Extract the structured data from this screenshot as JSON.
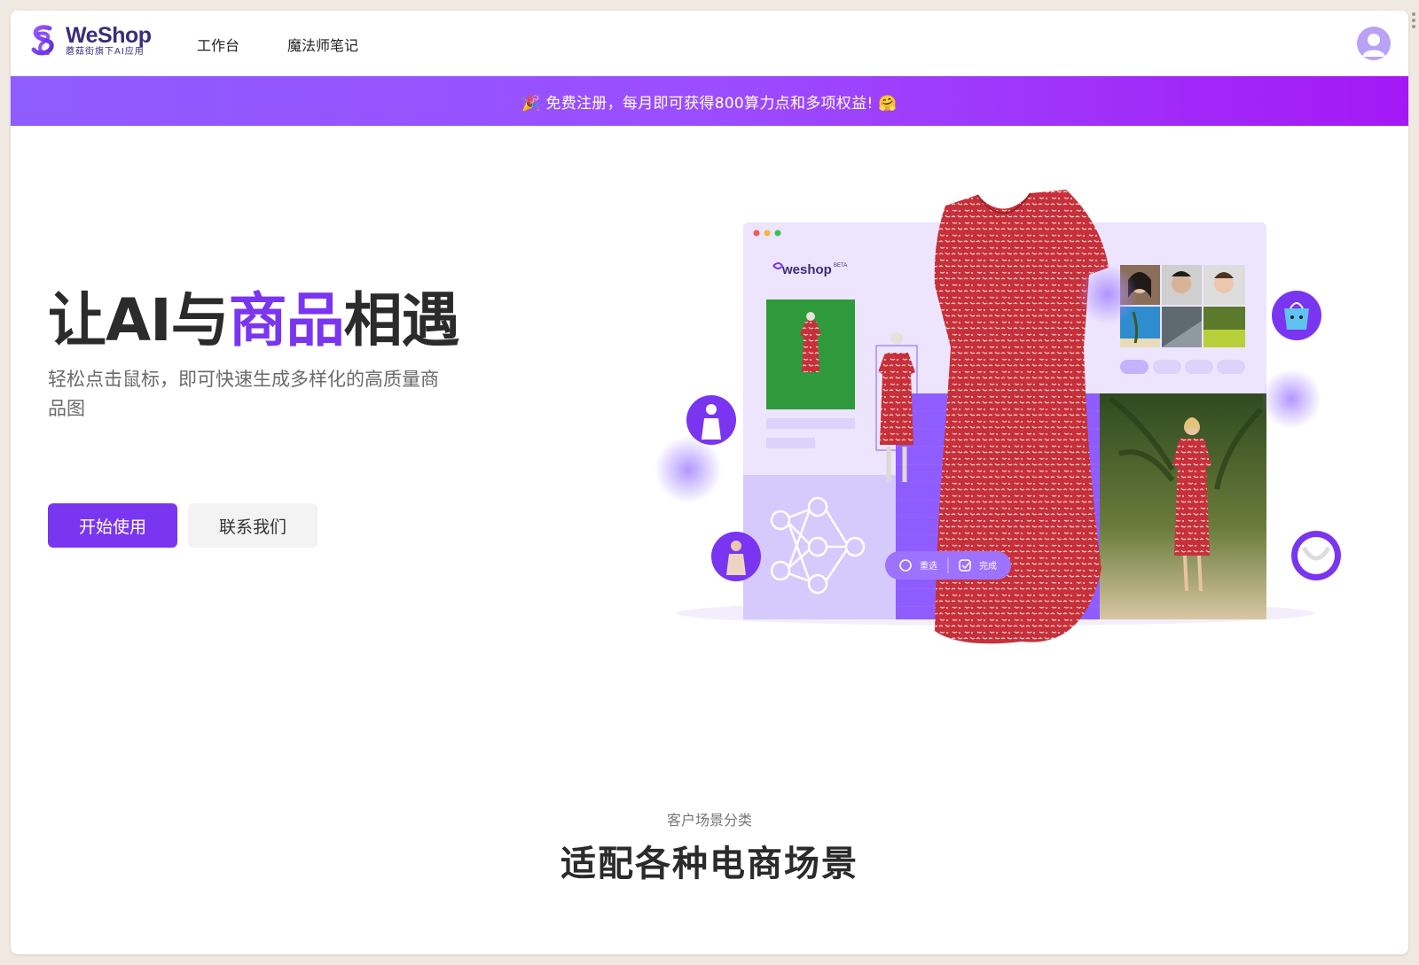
{
  "app": {
    "logo_name": "WeShop",
    "logo_sub": "蘑菇街旗下AI应用"
  },
  "nav": {
    "items": [
      {
        "label": "工作台"
      },
      {
        "label": "魔法师笔记"
      }
    ]
  },
  "banner": {
    "text": "🎉 免费注册，每月即可获得800算力点和多项权益! 🤗"
  },
  "hero": {
    "title_part1": "让AI与",
    "title_accent": "商品",
    "title_part2": "相遇",
    "subtitle": "轻松点击鼠标，即可快速生成多样化的高质量商品图",
    "primary_button": "开始使用",
    "secondary_button": "联系我们"
  },
  "illustration": {
    "app_name": "weshop",
    "beta_tag": "BETA",
    "reselect_label": "重选",
    "done_label": "完成"
  },
  "section": {
    "label": "客户场景分类",
    "title": "适配各种电商场景"
  },
  "colors": {
    "brand": "#7a35f0",
    "banner_start": "#8f5cff",
    "banner_end": "#a418f5",
    "dress": "#c7303a"
  },
  "icons": {
    "logo": "weshop-logo-icon",
    "avatar": "user-avatar-icon",
    "reselect": "refresh-icon",
    "done": "check-icon"
  }
}
